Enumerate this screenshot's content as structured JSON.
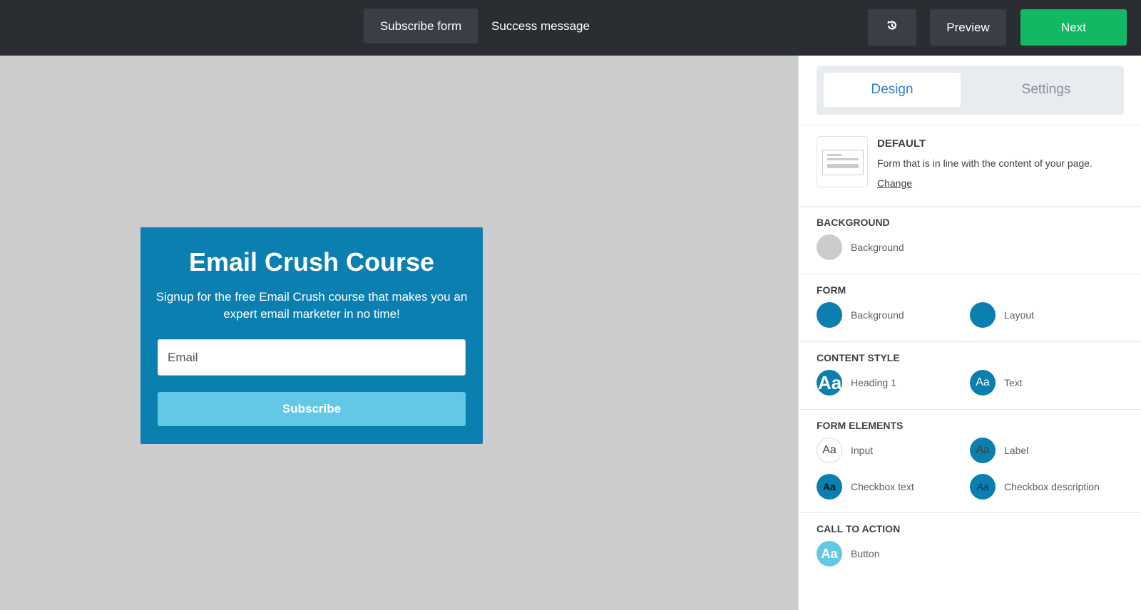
{
  "topbar": {
    "tab_subscribe": "Subscribe form",
    "tab_success": "Success message",
    "history_icon": "history-icon",
    "preview_label": "Preview",
    "next_label": "Next"
  },
  "form": {
    "heading": "Email Crush Course",
    "subtext": "Signup for the free Email Crush course that makes you an expert email marketer in no time!",
    "email_placeholder": "Email",
    "subscribe_label": "Subscribe"
  },
  "panel": {
    "tabs": {
      "design": "Design",
      "settings": "Settings"
    },
    "default": {
      "title": "DEFAULT",
      "description": "Form that is in line with the content of your page.",
      "change_label": "Change"
    },
    "sections": {
      "background": {
        "title": "BACKGROUND",
        "items": [
          {
            "label": "Background",
            "color": "#cccccc"
          }
        ]
      },
      "form": {
        "title": "FORM",
        "items": [
          {
            "label": "Background",
            "color": "#0a7fb0"
          },
          {
            "label": "Layout",
            "color": "#0a7fb0"
          }
        ]
      },
      "content_style": {
        "title": "CONTENT STYLE",
        "items": [
          {
            "label": "Heading 1",
            "glyph": "Aa",
            "color": "#0a7fb0"
          },
          {
            "label": "Text",
            "glyph": "Aa",
            "color": "#0a7fb0"
          }
        ]
      },
      "form_elements": {
        "title": "FORM ELEMENTS",
        "items": [
          {
            "label": "Input",
            "glyph": "Aa",
            "color": "#ffffff"
          },
          {
            "label": "Label",
            "glyph": "Aa",
            "color": "#0a7fb0"
          },
          {
            "label": "Checkbox text",
            "glyph": "Aa",
            "color": "#0a7fb0"
          },
          {
            "label": "Checkbox description",
            "glyph": "Aa",
            "color": "#0a7fb0"
          }
        ]
      },
      "call_to_action": {
        "title": "CALL TO ACTION",
        "items": [
          {
            "label": "Button",
            "glyph": "Aa",
            "color": "#63c8e6"
          }
        ]
      }
    }
  },
  "colors": {
    "topbar": "#2a2d32",
    "next_green": "#12b864",
    "form_blue": "#0a7fb0",
    "button_light_blue": "#63c8e6",
    "canvas_gray": "#cccccc",
    "design_tab_blue": "#2b7cd6"
  }
}
